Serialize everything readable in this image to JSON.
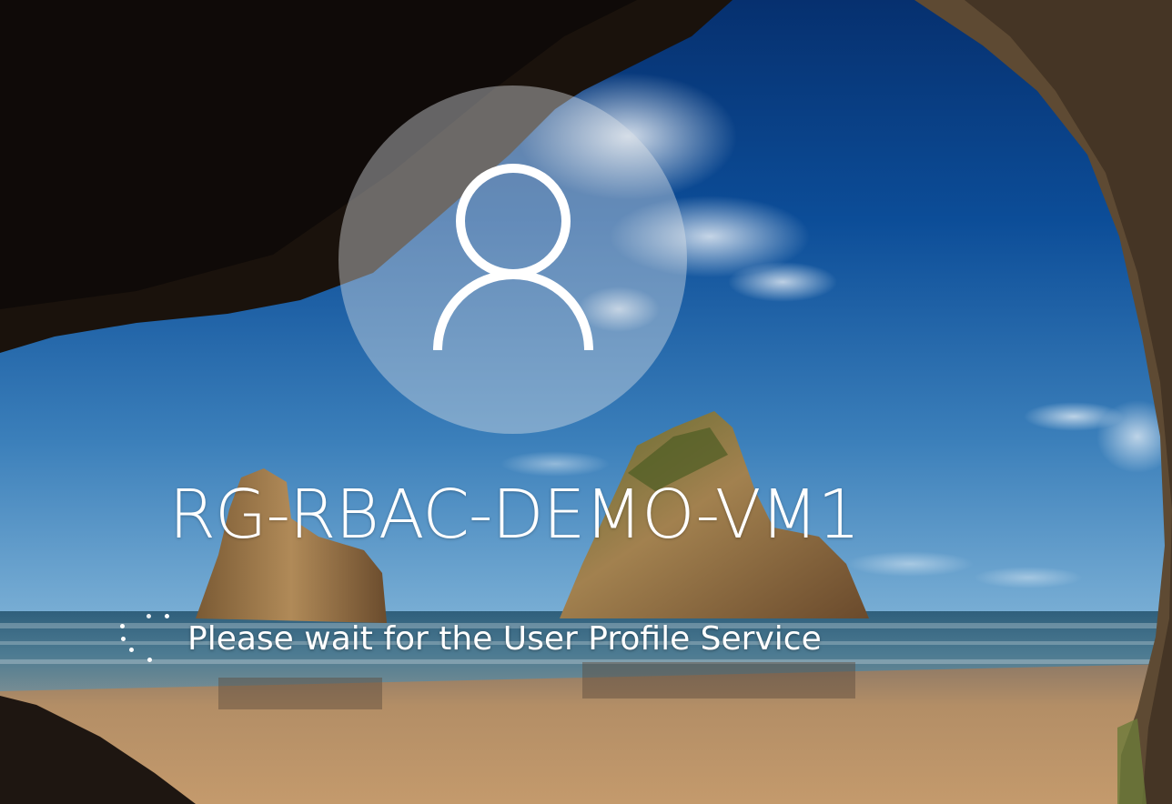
{
  "lock_screen": {
    "machine_name": "RG-RBAC-DEMO-VM1",
    "status_message": "Please wait for the User Profile Service",
    "avatar_icon": "user-silhouette-icon",
    "spinner_icon": "loading-dots-icon",
    "background_scene": "sea cave beach with rock stacks"
  },
  "colors": {
    "text": "#ffffff",
    "sky_top": "#0a3f8c",
    "sky_horizon": "#6aa4cf",
    "sand": "#b99164",
    "cave_rock": "#1a120c"
  }
}
